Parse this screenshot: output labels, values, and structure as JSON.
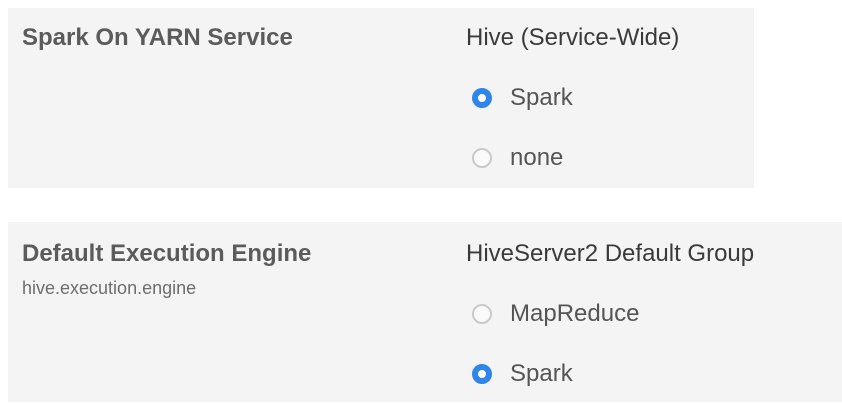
{
  "sections": [
    {
      "title": "Spark On YARN Service",
      "subtitle": "",
      "scope": "Hive (Service-Wide)",
      "options": [
        {
          "label": "Spark",
          "checked": true
        },
        {
          "label": "none",
          "checked": false
        }
      ]
    },
    {
      "title": "Default Execution Engine",
      "subtitle": "hive.execution.engine",
      "scope": "HiveServer2 Default Group",
      "options": [
        {
          "label": "MapReduce",
          "checked": false
        },
        {
          "label": "Spark",
          "checked": true
        }
      ]
    }
  ],
  "colors": {
    "panel_bg": "#f4f4f4",
    "radio_selected": "#2f86e8",
    "radio_unselected_border": "#c9c9c9"
  }
}
